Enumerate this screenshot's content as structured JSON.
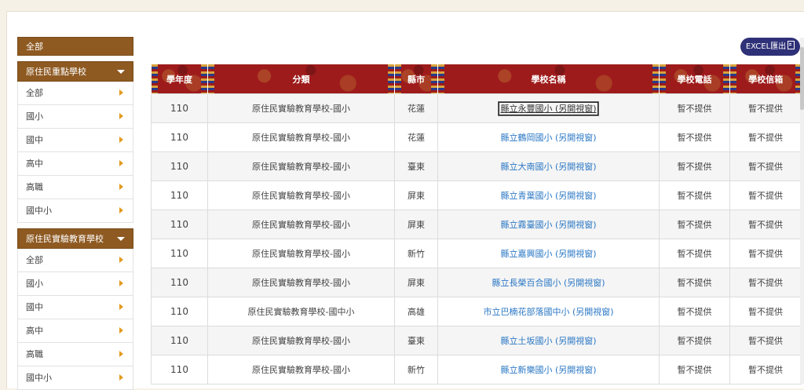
{
  "sidebar": {
    "all_label": "全部",
    "groups": [
      {
        "title": "原住民重點學校",
        "items": [
          "全部",
          "國小",
          "國中",
          "高中",
          "高職",
          "國中小"
        ]
      },
      {
        "title": "原住民實驗教育學校",
        "items": [
          "全部",
          "國小",
          "國中",
          "高中",
          "高職",
          "國中小"
        ]
      }
    ]
  },
  "toolbar": {
    "excel_label": "EXCEL匯出"
  },
  "table": {
    "headers": [
      "學年度",
      "分類",
      "縣市",
      "學校名稱",
      "學校電話",
      "學校信箱"
    ],
    "rows": [
      {
        "year": "110",
        "category": "原住民實驗教育學校-國小",
        "city": "花蓮",
        "school": "縣立永豐國小 (另開視窗)",
        "phone": "暫不提供",
        "email": "暫不提供"
      },
      {
        "year": "110",
        "category": "原住民實驗教育學校-國小",
        "city": "花蓮",
        "school": "縣立鶴岡國小 (另開視窗)",
        "phone": "暫不提供",
        "email": "暫不提供"
      },
      {
        "year": "110",
        "category": "原住民實驗教育學校-國小",
        "city": "臺東",
        "school": "縣立大南國小 (另開視窗)",
        "phone": "暫不提供",
        "email": "暫不提供"
      },
      {
        "year": "110",
        "category": "原住民實驗教育學校-國小",
        "city": "屏東",
        "school": "縣立青葉國小 (另開視窗)",
        "phone": "暫不提供",
        "email": "暫不提供"
      },
      {
        "year": "110",
        "category": "原住民實驗教育學校-國小",
        "city": "屏東",
        "school": "縣立霧臺國小 (另開視窗)",
        "phone": "暫不提供",
        "email": "暫不提供"
      },
      {
        "year": "110",
        "category": "原住民實驗教育學校-國小",
        "city": "新竹",
        "school": "縣立嘉興國小 (另開視窗)",
        "phone": "暫不提供",
        "email": "暫不提供"
      },
      {
        "year": "110",
        "category": "原住民實驗教育學校-國小",
        "city": "屏東",
        "school": "縣立長榮百合國小 (另開視窗)",
        "phone": "暫不提供",
        "email": "暫不提供"
      },
      {
        "year": "110",
        "category": "原住民實驗教育學校-國中小",
        "city": "高雄",
        "school": "市立巴楠花部落國中小 (另開視窗)",
        "phone": "暫不提供",
        "email": "暫不提供"
      },
      {
        "year": "110",
        "category": "原住民實驗教育學校-國小",
        "city": "臺東",
        "school": "縣立土坂國小 (另開視窗)",
        "phone": "暫不提供",
        "email": "暫不提供"
      },
      {
        "year": "110",
        "category": "原住民實驗教育學校-國小",
        "city": "新竹",
        "school": "縣立新樂國小 (另開視窗)",
        "phone": "暫不提供",
        "email": "暫不提供"
      }
    ]
  },
  "colors": {
    "sidebar_header": "#8e5a22",
    "table_header": "#9e1b1b",
    "link": "#2a77c4",
    "arrow": "#e39a1e",
    "excel_button": "#2f3178"
  }
}
